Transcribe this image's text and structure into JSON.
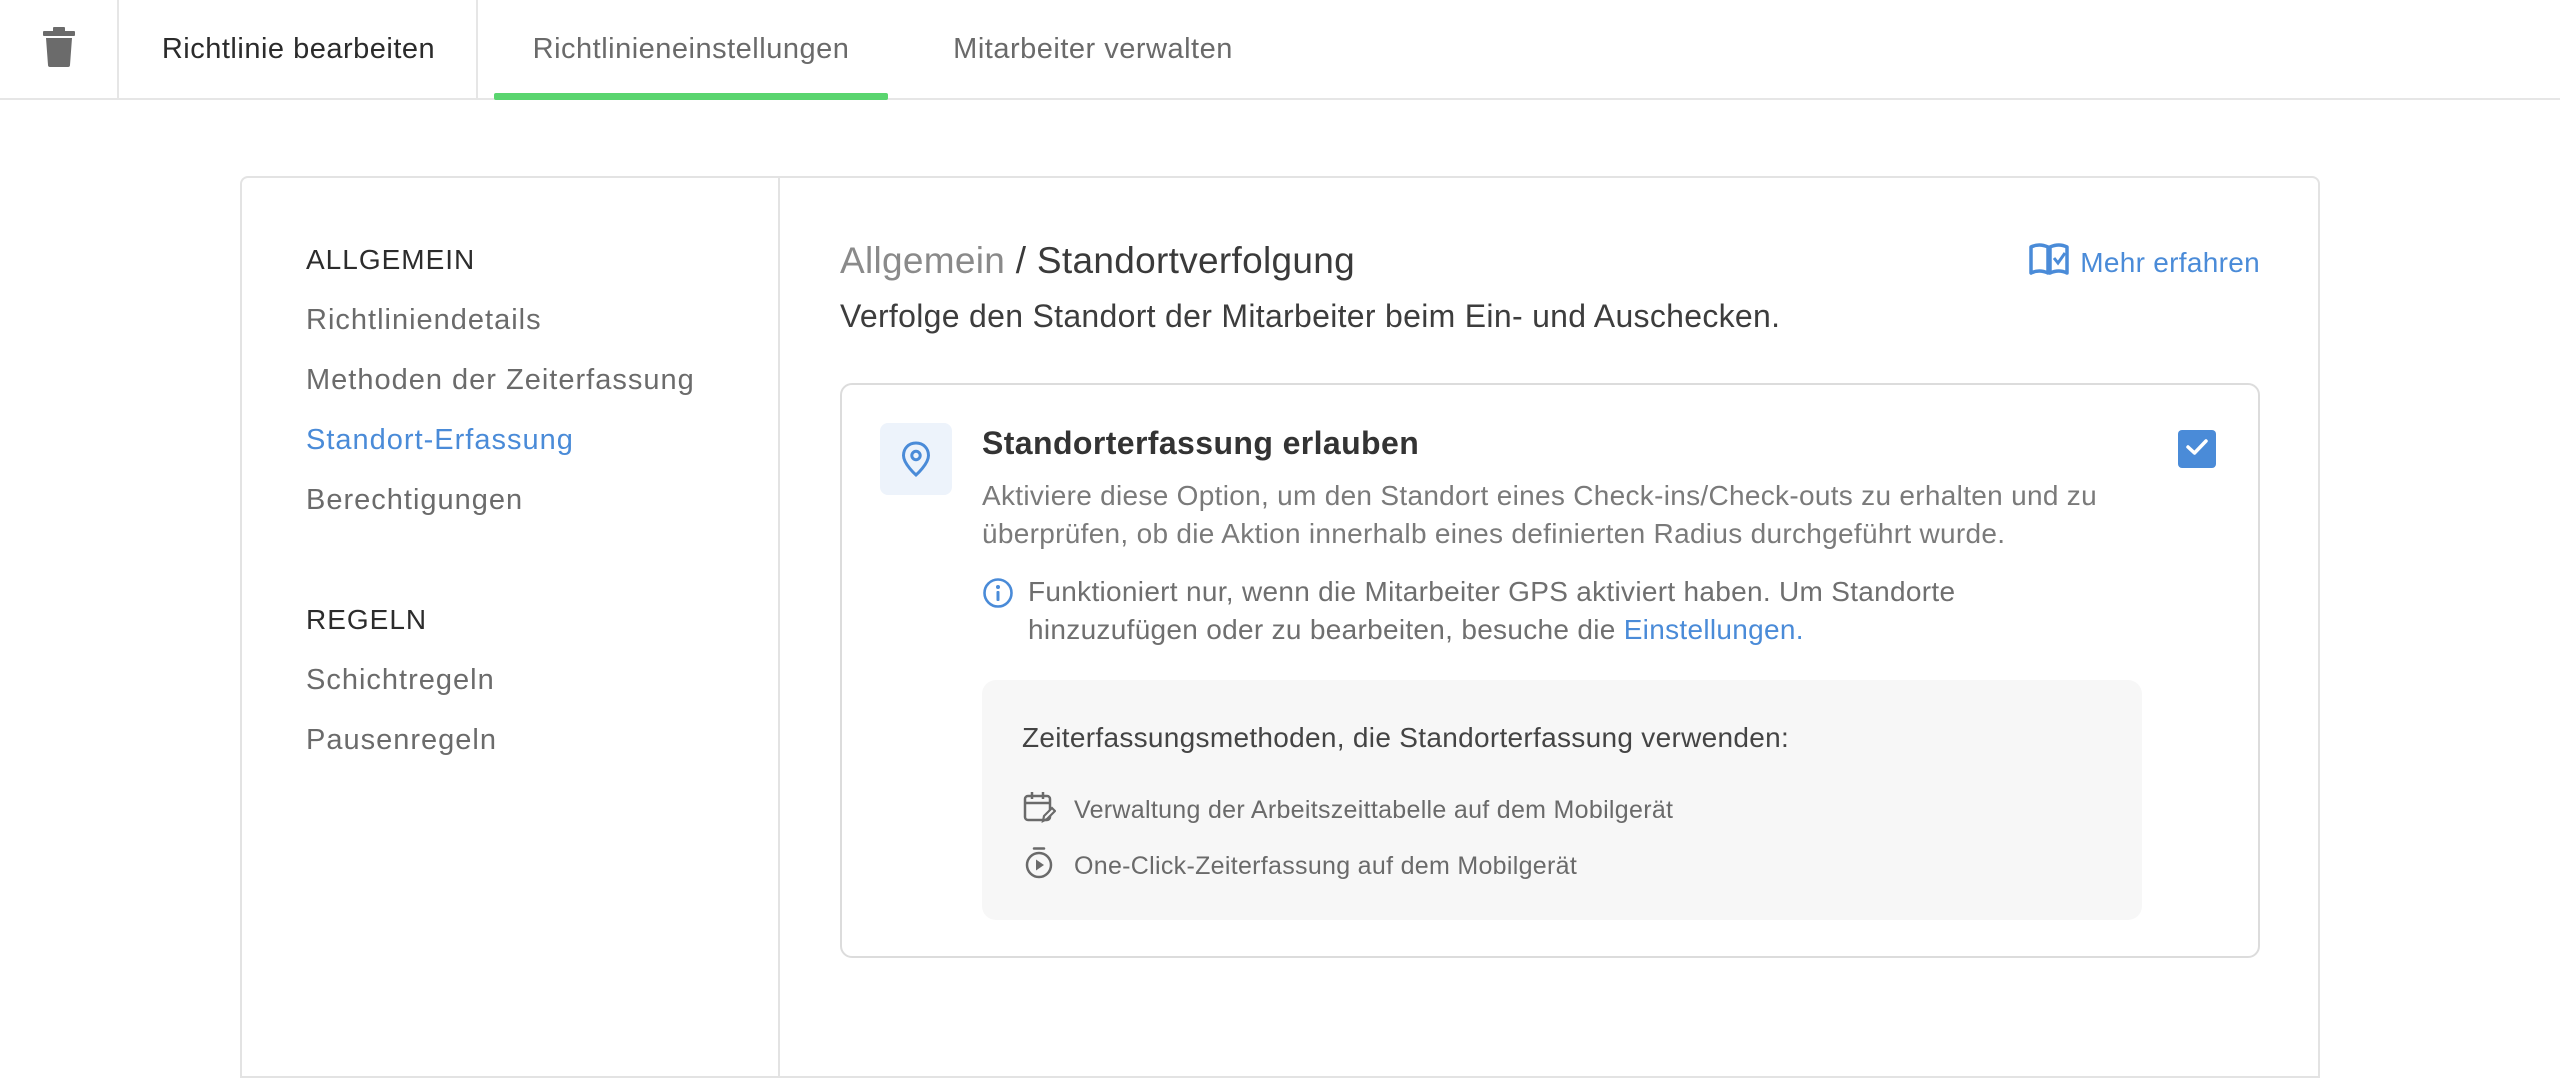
{
  "tabs": {
    "edit_policy": "Richtlinie bearbeiten",
    "policy_settings": "Richtlinieneinstellungen",
    "manage_employees": "Mitarbeiter verwalten"
  },
  "sidebar": {
    "general_heading": "ALLGEMEIN",
    "general_items": [
      {
        "label": "Richtliniendetails"
      },
      {
        "label": "Methoden der Zeiterfassung"
      },
      {
        "label": "Standort-Erfassung"
      },
      {
        "label": "Berechtigungen"
      }
    ],
    "rules_heading": "REGELN",
    "rules_items": [
      {
        "label": "Schichtregeln"
      },
      {
        "label": "Pausenregeln"
      }
    ]
  },
  "content": {
    "breadcrumb_parent": "Allgemein",
    "breadcrumb_separator": " / ",
    "breadcrumb_current": "Standortverfolgung",
    "learn_more": "Mehr erfahren",
    "subtitle": "Verfolge den Standort der Mitarbeiter beim Ein- und Auschecken."
  },
  "option": {
    "title": "Standorterfassung erlauben",
    "description": "Aktiviere diese Option, um den Standort eines Check-ins/Check-outs zu erhalten und zu überprüfen, ob die Aktion innerhalb eines definierten Radius durchgeführt wurde.",
    "checked": true,
    "info_text": "Funktioniert nur, wenn die Mitarbeiter GPS aktiviert haben. Um Standorte hinzuzufügen oder zu bearbeiten, besuche die ",
    "info_link": "Einstellungen."
  },
  "methods": {
    "title": "Zeiterfassungsmethoden, die Standorterfassung verwenden:",
    "items": [
      {
        "label": "Verwaltung der Arbeitszeittabelle auf dem Mobilgerät",
        "icon": "calendar-edit-icon"
      },
      {
        "label": "One-Click-Zeiterfassung auf dem Mobilgerät",
        "icon": "stopwatch-icon"
      }
    ]
  },
  "colors": {
    "accent_blue": "#4a8bd8",
    "active_tab_underline": "#5ad56f",
    "border": "#e3e3e3",
    "methods_bg": "#f7f7f7"
  }
}
